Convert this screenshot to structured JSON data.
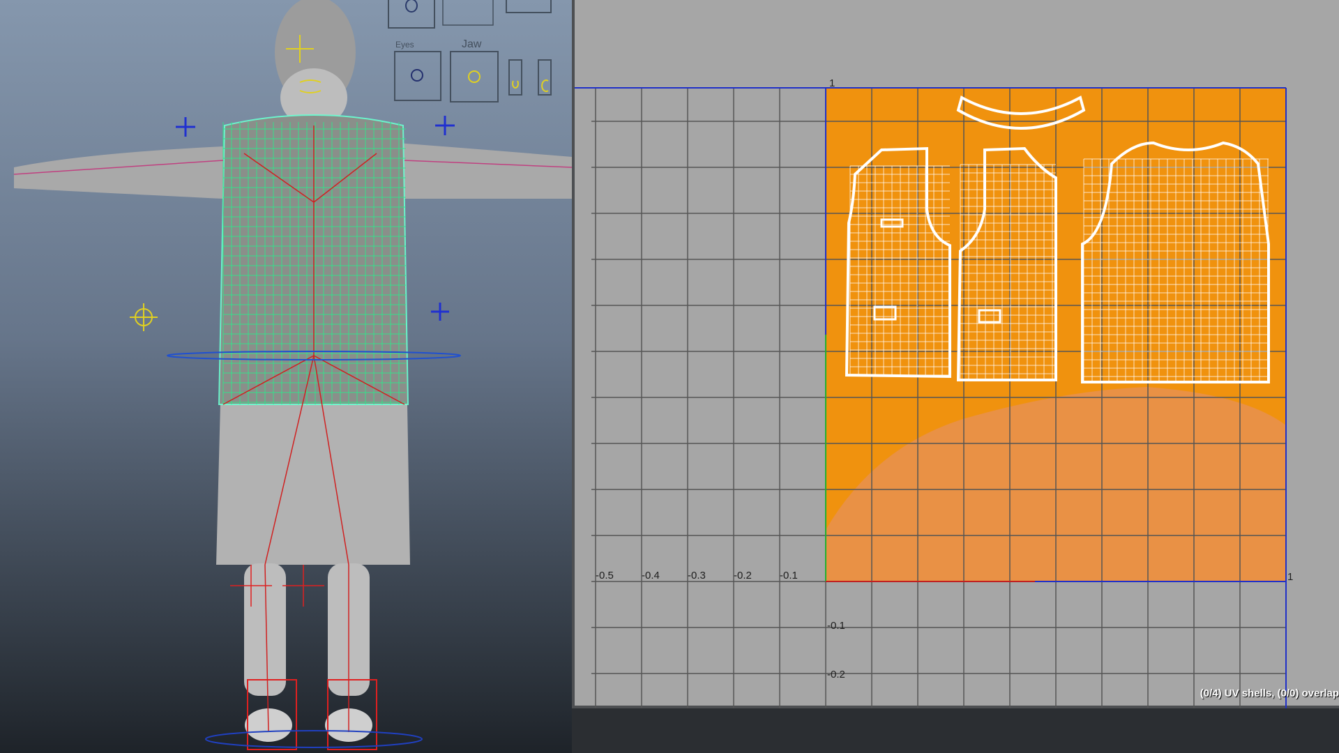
{
  "viewport3d": {
    "character_model": "bearded-man-t-pose",
    "picker": {
      "jaw_label": "Jaw"
    }
  },
  "uv_editor": {
    "axis_labels_u": [
      "-0.5",
      "-0.4",
      "-0.3",
      "-0.2",
      "-0.1"
    ],
    "axis_label_u_one": "1",
    "axis_label_v_one": "1",
    "axis_labels_v_neg": [
      "-0.1",
      "-0.2"
    ],
    "status": "(0/4) UV shells, (0/0) overlap",
    "colors": {
      "background": "#a6a6a6",
      "texture": "#f0920e",
      "wireframe": "#ffffff",
      "grid": "#555555"
    },
    "shells": [
      "collar-shell",
      "front-left-shell",
      "front-right-shell",
      "back-shell"
    ]
  }
}
